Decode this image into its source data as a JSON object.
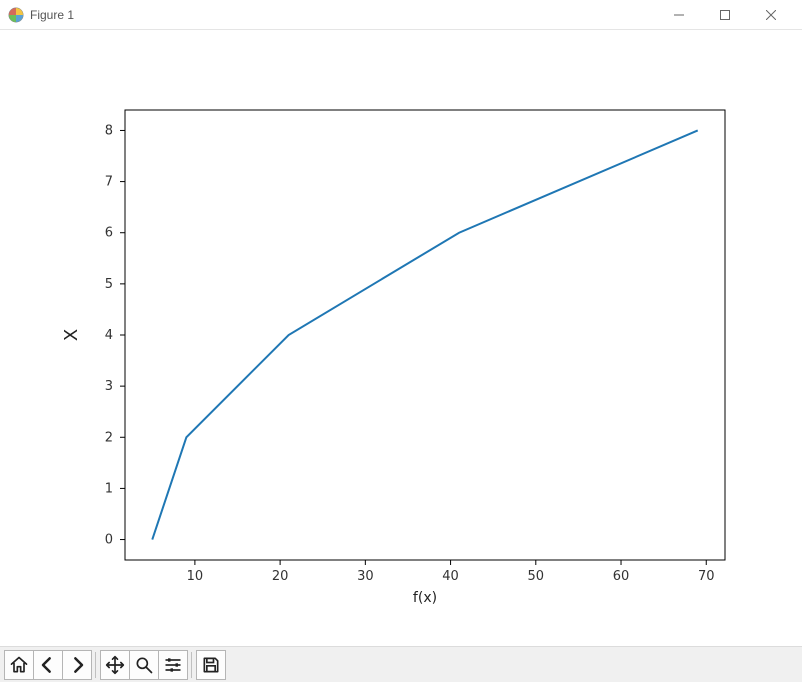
{
  "window": {
    "title": "Figure 1"
  },
  "chart_data": {
    "type": "line",
    "x": [
      5,
      9,
      21,
      41,
      69
    ],
    "y": [
      0,
      2,
      4,
      6,
      8
    ],
    "xlabel": "f(x)",
    "ylabel": "X",
    "xlim": [
      1.8,
      72.2
    ],
    "ylim": [
      -0.4,
      8.4
    ],
    "xticks": [
      10,
      20,
      30,
      40,
      50,
      60,
      70
    ],
    "yticks": [
      0,
      1,
      2,
      3,
      4,
      5,
      6,
      7,
      8
    ],
    "line_color": "#1f77b4"
  },
  "toolbar": {
    "home": "Home",
    "back": "Back",
    "forward": "Forward",
    "pan": "Pan",
    "zoom": "Zoom",
    "configure": "Configure subplots",
    "save": "Save"
  }
}
